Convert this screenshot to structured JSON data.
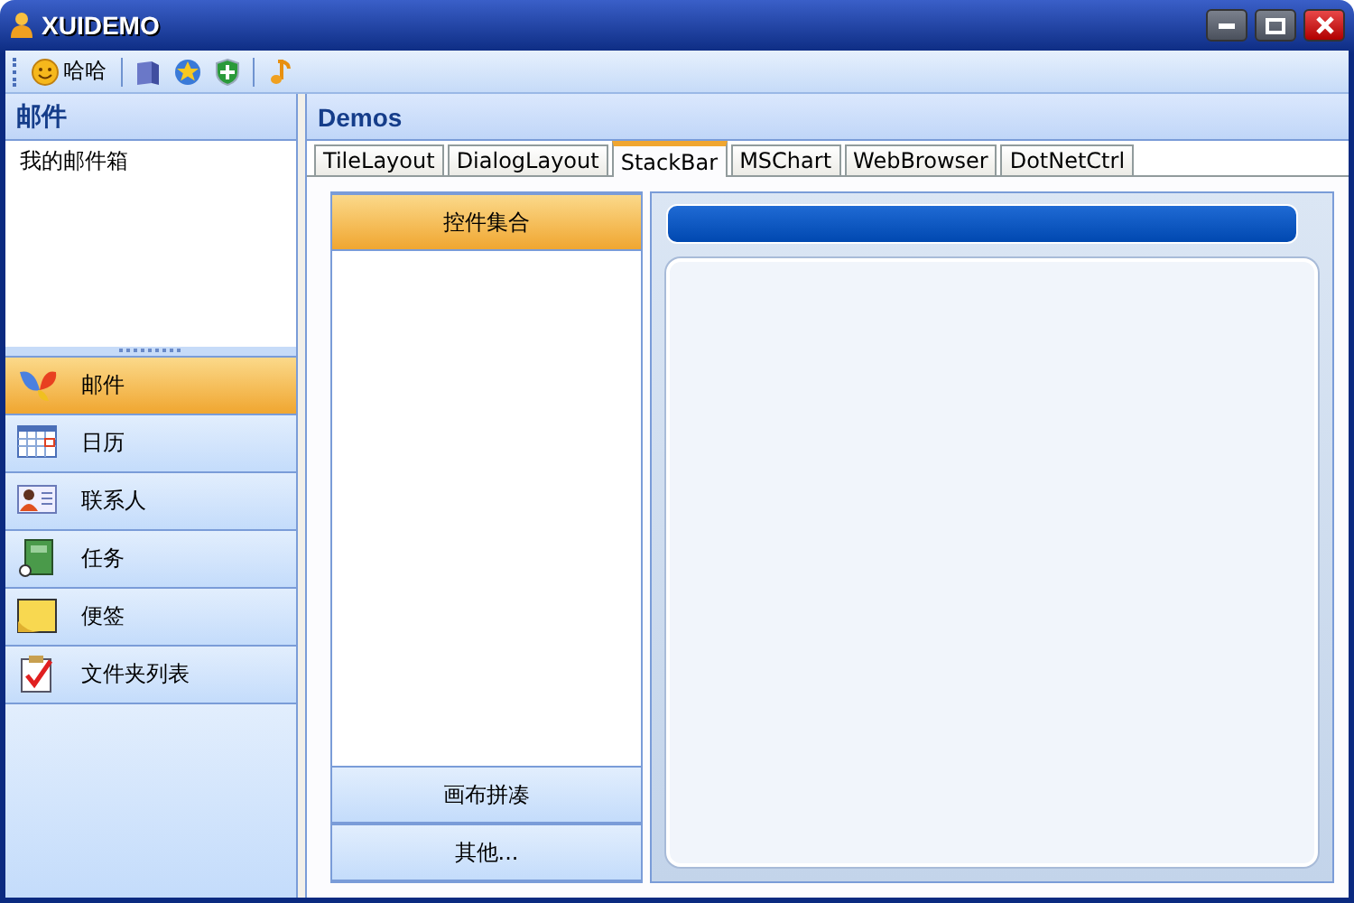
{
  "window": {
    "title": "XUIDEMO"
  },
  "toolbar": [
    {
      "kind": "button",
      "label": "哈哈"
    },
    {
      "kind": "separator"
    },
    {
      "kind": "icon"
    },
    {
      "kind": "icon"
    },
    {
      "kind": "icon"
    },
    {
      "kind": "separator"
    },
    {
      "kind": "icon"
    }
  ],
  "left_pane": {
    "title": "邮件",
    "tree_items": [
      {
        "label": "我的邮件箱",
        "selected": false
      }
    ]
  },
  "nav_items": [
    {
      "label": "邮件",
      "selected": true
    },
    {
      "label": "日历",
      "selected": false
    },
    {
      "label": "联系人",
      "selected": false
    },
    {
      "label": "任务",
      "selected": false
    },
    {
      "label": "便签",
      "selected": false
    },
    {
      "label": "文件夹列表",
      "selected": false
    }
  ],
  "right_pane": {
    "title": "Demos"
  },
  "tabs": [
    {
      "label": "TileLayout",
      "selected": false
    },
    {
      "label": "DialogLayout",
      "selected": false
    },
    {
      "label": "StackBar",
      "selected": true
    },
    {
      "label": "MSChart",
      "selected": false
    },
    {
      "label": "WebBrowser",
      "selected": false
    },
    {
      "label": "DotNetCtrl",
      "selected": false
    }
  ],
  "stack_top": [
    {
      "label": "控件集合",
      "selected": true
    }
  ],
  "stack_bottom": [
    {
      "label": "画布拼凑",
      "selected": false
    },
    {
      "label": "其他...",
      "selected": false
    }
  ]
}
